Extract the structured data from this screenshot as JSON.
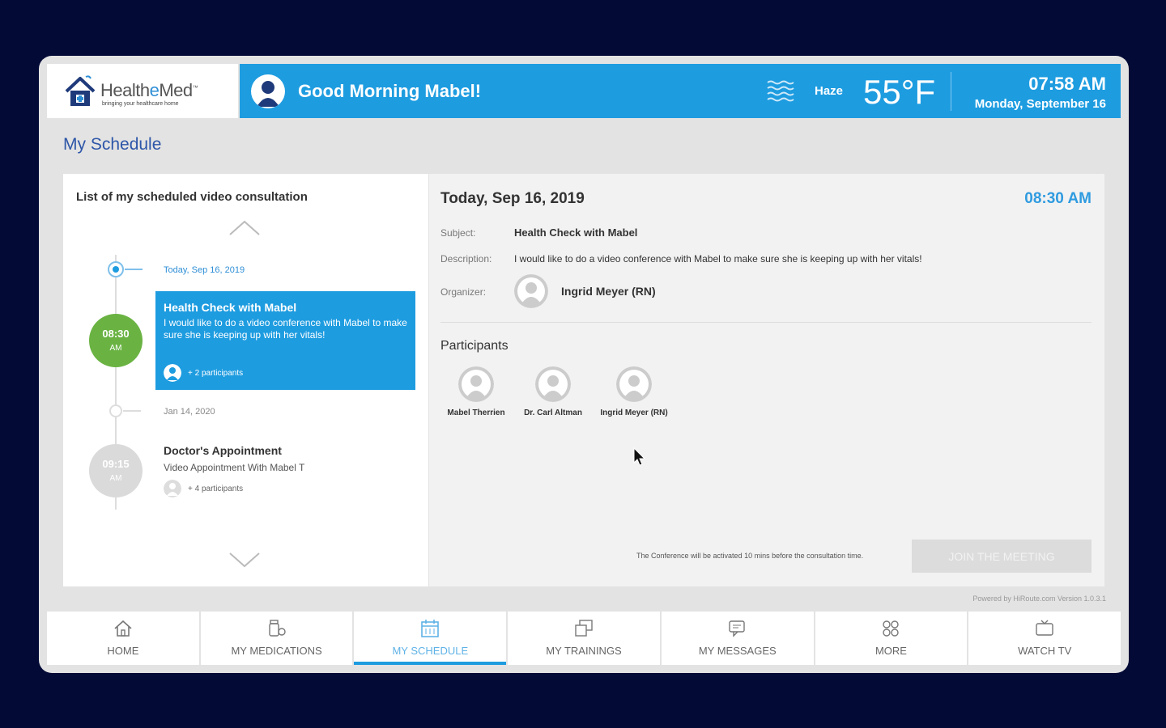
{
  "brand": {
    "name_part1": "Health",
    "name_e": "e",
    "name_part2": "Med",
    "trademark": "™",
    "tagline": "bringing your healthcare home"
  },
  "header": {
    "greeting": "Good Morning Mabel!",
    "weather_icon": "haze-icon",
    "weather_desc": "Haze",
    "temperature": "55°F",
    "time": "07:58 AM",
    "date": "Monday, September 16"
  },
  "page": {
    "title": "My Schedule"
  },
  "schedule_list": {
    "title": "List of my scheduled video consultation",
    "items": [
      {
        "date_label": "Today, Sep 16, 2019",
        "time": "08:30",
        "ampm": "AM",
        "title": "Health Check with Mabel",
        "description": "I would like to do a video conference with Mabel to make sure she is keeping up with her vitals!",
        "participants": "+ 2 participants"
      },
      {
        "date_label": "Jan 14, 2020",
        "time": "09:15",
        "ampm": "AM",
        "title": "Doctor's Appointment",
        "description": "Video Appointment With Mabel T",
        "participants": "+ 4 participants"
      }
    ]
  },
  "detail": {
    "date": "Today, Sep 16, 2019",
    "time": "08:30 AM",
    "subject_label": "Subject:",
    "subject": "Health Check with Mabel",
    "description_label": "Description:",
    "description": "I would like to do a video conference with Mabel to make sure she is keeping up with her vitals!",
    "organizer_label": "Organizer:",
    "organizer": "Ingrid Meyer (RN)",
    "participants_title": "Participants",
    "participants": [
      "Mabel Therrien",
      "Dr. Carl Altman",
      "Ingrid Meyer (RN)"
    ],
    "note": "The Conference will be activated 10 mins before the consultation time.",
    "join_label": "JOIN THE MEETING"
  },
  "footer": {
    "powered_by": "Powered by HiRoute.com Version 1.0.3.1"
  },
  "nav": {
    "items": [
      {
        "label": "HOME",
        "icon": "home-icon"
      },
      {
        "label": "MY MEDICATIONS",
        "icon": "medications-icon"
      },
      {
        "label": "MY SCHEDULE",
        "icon": "calendar-icon",
        "active": true
      },
      {
        "label": "MY TRAININGS",
        "icon": "trainings-icon"
      },
      {
        "label": "MY MESSAGES",
        "icon": "messages-icon"
      },
      {
        "label": "MORE",
        "icon": "grid-icon"
      },
      {
        "label": "WATCH TV",
        "icon": "tv-icon"
      }
    ]
  },
  "colors": {
    "background": "#030a36",
    "accent": "#1e9ce0",
    "time_badge_active": "#6ab343",
    "title_blue": "#2d56a8"
  }
}
